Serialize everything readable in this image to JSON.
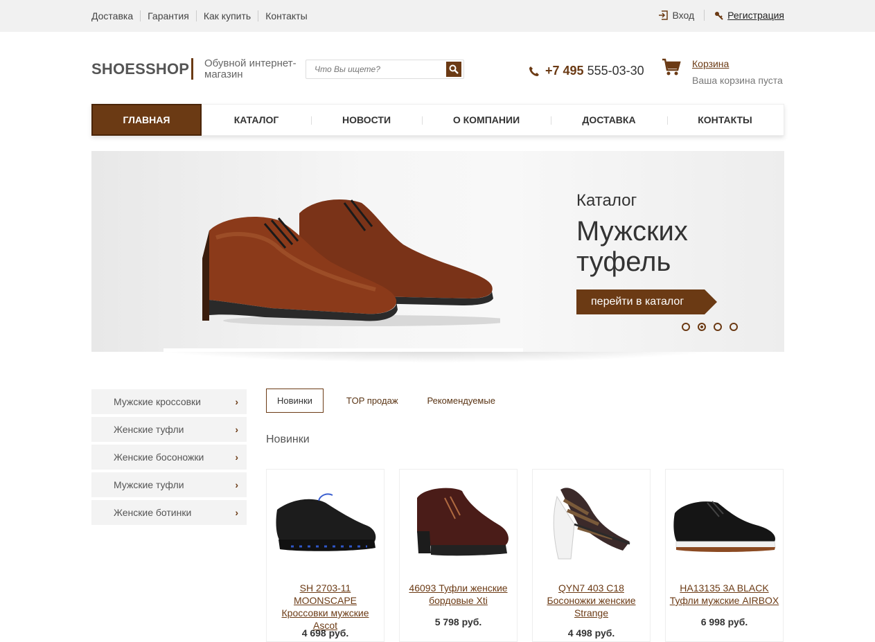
{
  "topbar": {
    "links": [
      "Доставка",
      "Гарантия",
      "Как купить",
      "Контакты"
    ],
    "login": "Вход",
    "register": "Регистрация"
  },
  "header": {
    "logo": "SHOESSHOP",
    "tagline": "Обувной интернет-магазин",
    "search_placeholder": "Что Вы ищете?",
    "phone_code": "+7 495",
    "phone_number": " 555-03-30",
    "cart_label": "Корзина",
    "cart_status": "Ваша корзина пуста"
  },
  "mainnav": {
    "items": [
      "ГЛАВНАЯ",
      "КАТАЛОГ",
      "НОВОСТИ",
      "О КОМПАНИИ",
      "ДОСТАВКА",
      "КОНТАКТЫ"
    ],
    "active_index": 0
  },
  "banner": {
    "subtitle": "Каталог",
    "title": "Мужских туфель",
    "button": "перейти в каталог",
    "slides": 4,
    "active_slide": 2
  },
  "sidebar": {
    "items": [
      "Мужские кроссовки",
      "Женские туфли",
      "Женские босоножки",
      "Мужские туфли",
      "Женские ботинки"
    ]
  },
  "tabs": {
    "items": [
      "Новинки",
      "TOP продаж",
      "Рекомендуемые"
    ],
    "active_index": 0
  },
  "section_title": "Новинки",
  "products": [
    {
      "name": "SH 2703-11 MOONSCAPE Кроссовки мужские Ascot",
      "price": "4 698 руб."
    },
    {
      "name": "46093 Туфли женские бордовые Xti",
      "price": "5 798 руб."
    },
    {
      "name": "QYN7 403 C18 Босоножки женские Strange",
      "price": "4 498 руб."
    },
    {
      "name": "HA13135 3A BLACK Туфли мужские AIRBOX",
      "price": "6 998 руб."
    }
  ],
  "colors": {
    "brand": "#6b3a14",
    "topbar_bg": "#f1f1f1"
  }
}
